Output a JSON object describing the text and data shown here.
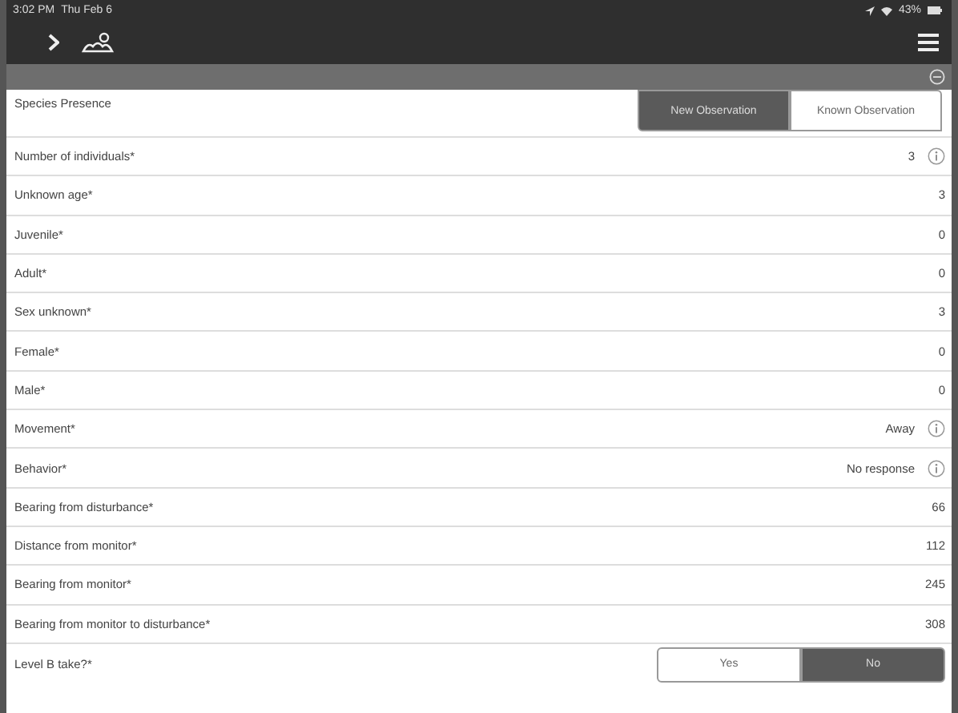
{
  "status_bar": {
    "time": "3:02 PM",
    "date": "Thu Feb 6",
    "battery": "43%"
  },
  "species_presence": {
    "label": "Species Presence",
    "options": [
      {
        "label": "New Observation",
        "selected": true
      },
      {
        "label": "Known Observation",
        "selected": false
      }
    ]
  },
  "fields": [
    {
      "label": "Number of individuals*",
      "value": "3",
      "info": true
    },
    {
      "label": "Unknown age*",
      "value": "3",
      "info": false
    },
    {
      "label": "Juvenile*",
      "value": "0",
      "info": false
    },
    {
      "label": "Adult*",
      "value": "0",
      "info": false
    },
    {
      "label": "Sex unknown*",
      "value": "3",
      "info": false
    },
    {
      "label": "Female*",
      "value": "0",
      "info": false
    },
    {
      "label": "Male*",
      "value": "0",
      "info": false
    },
    {
      "label": "Movement*",
      "value": "Away",
      "info": true
    },
    {
      "label": "Behavior*",
      "value": "No response",
      "info": true
    },
    {
      "label": "Bearing from disturbance*",
      "value": "66",
      "info": false
    },
    {
      "label": "Distance from monitor*",
      "value": "112",
      "info": false
    },
    {
      "label": "Bearing from monitor*",
      "value": "245",
      "info": false
    },
    {
      "label": "Bearing from monitor to disturbance*",
      "value": "308",
      "info": false
    }
  ],
  "level_b": {
    "label": "Level B take?*",
    "options": [
      {
        "label": "Yes",
        "selected": false
      },
      {
        "label": "No",
        "selected": true
      }
    ]
  }
}
